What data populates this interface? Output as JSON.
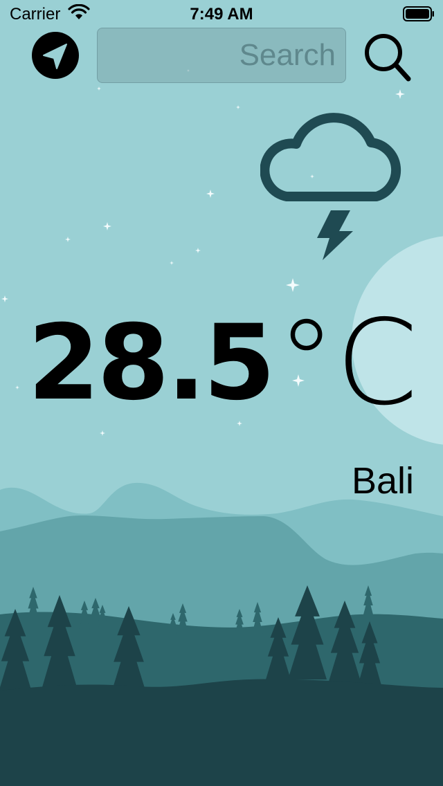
{
  "status_bar": {
    "carrier": "Carrier",
    "time": "7:49 AM",
    "wifi_icon": "wifi-icon",
    "battery_icon": "battery-full-icon"
  },
  "header": {
    "location_button_icon": "location-arrow-icon",
    "search_placeholder": "Search",
    "search_value": "",
    "search_button_icon": "magnifying-glass-icon"
  },
  "weather": {
    "condition_icon": "cloud-bolt-icon",
    "temperature_value": "28.5",
    "temperature_unit": "°C",
    "city": "Bali"
  },
  "colors": {
    "sky": "#9ad0d4",
    "moon": "#bfe4e8",
    "icon_dark": "#1f4a52",
    "mountain_far": "#80bfc4",
    "mountain_mid": "#63a5aa",
    "hill": "#2e676c",
    "ground": "#1d4349",
    "stars": "#f3fbfc",
    "text": "#000000"
  }
}
